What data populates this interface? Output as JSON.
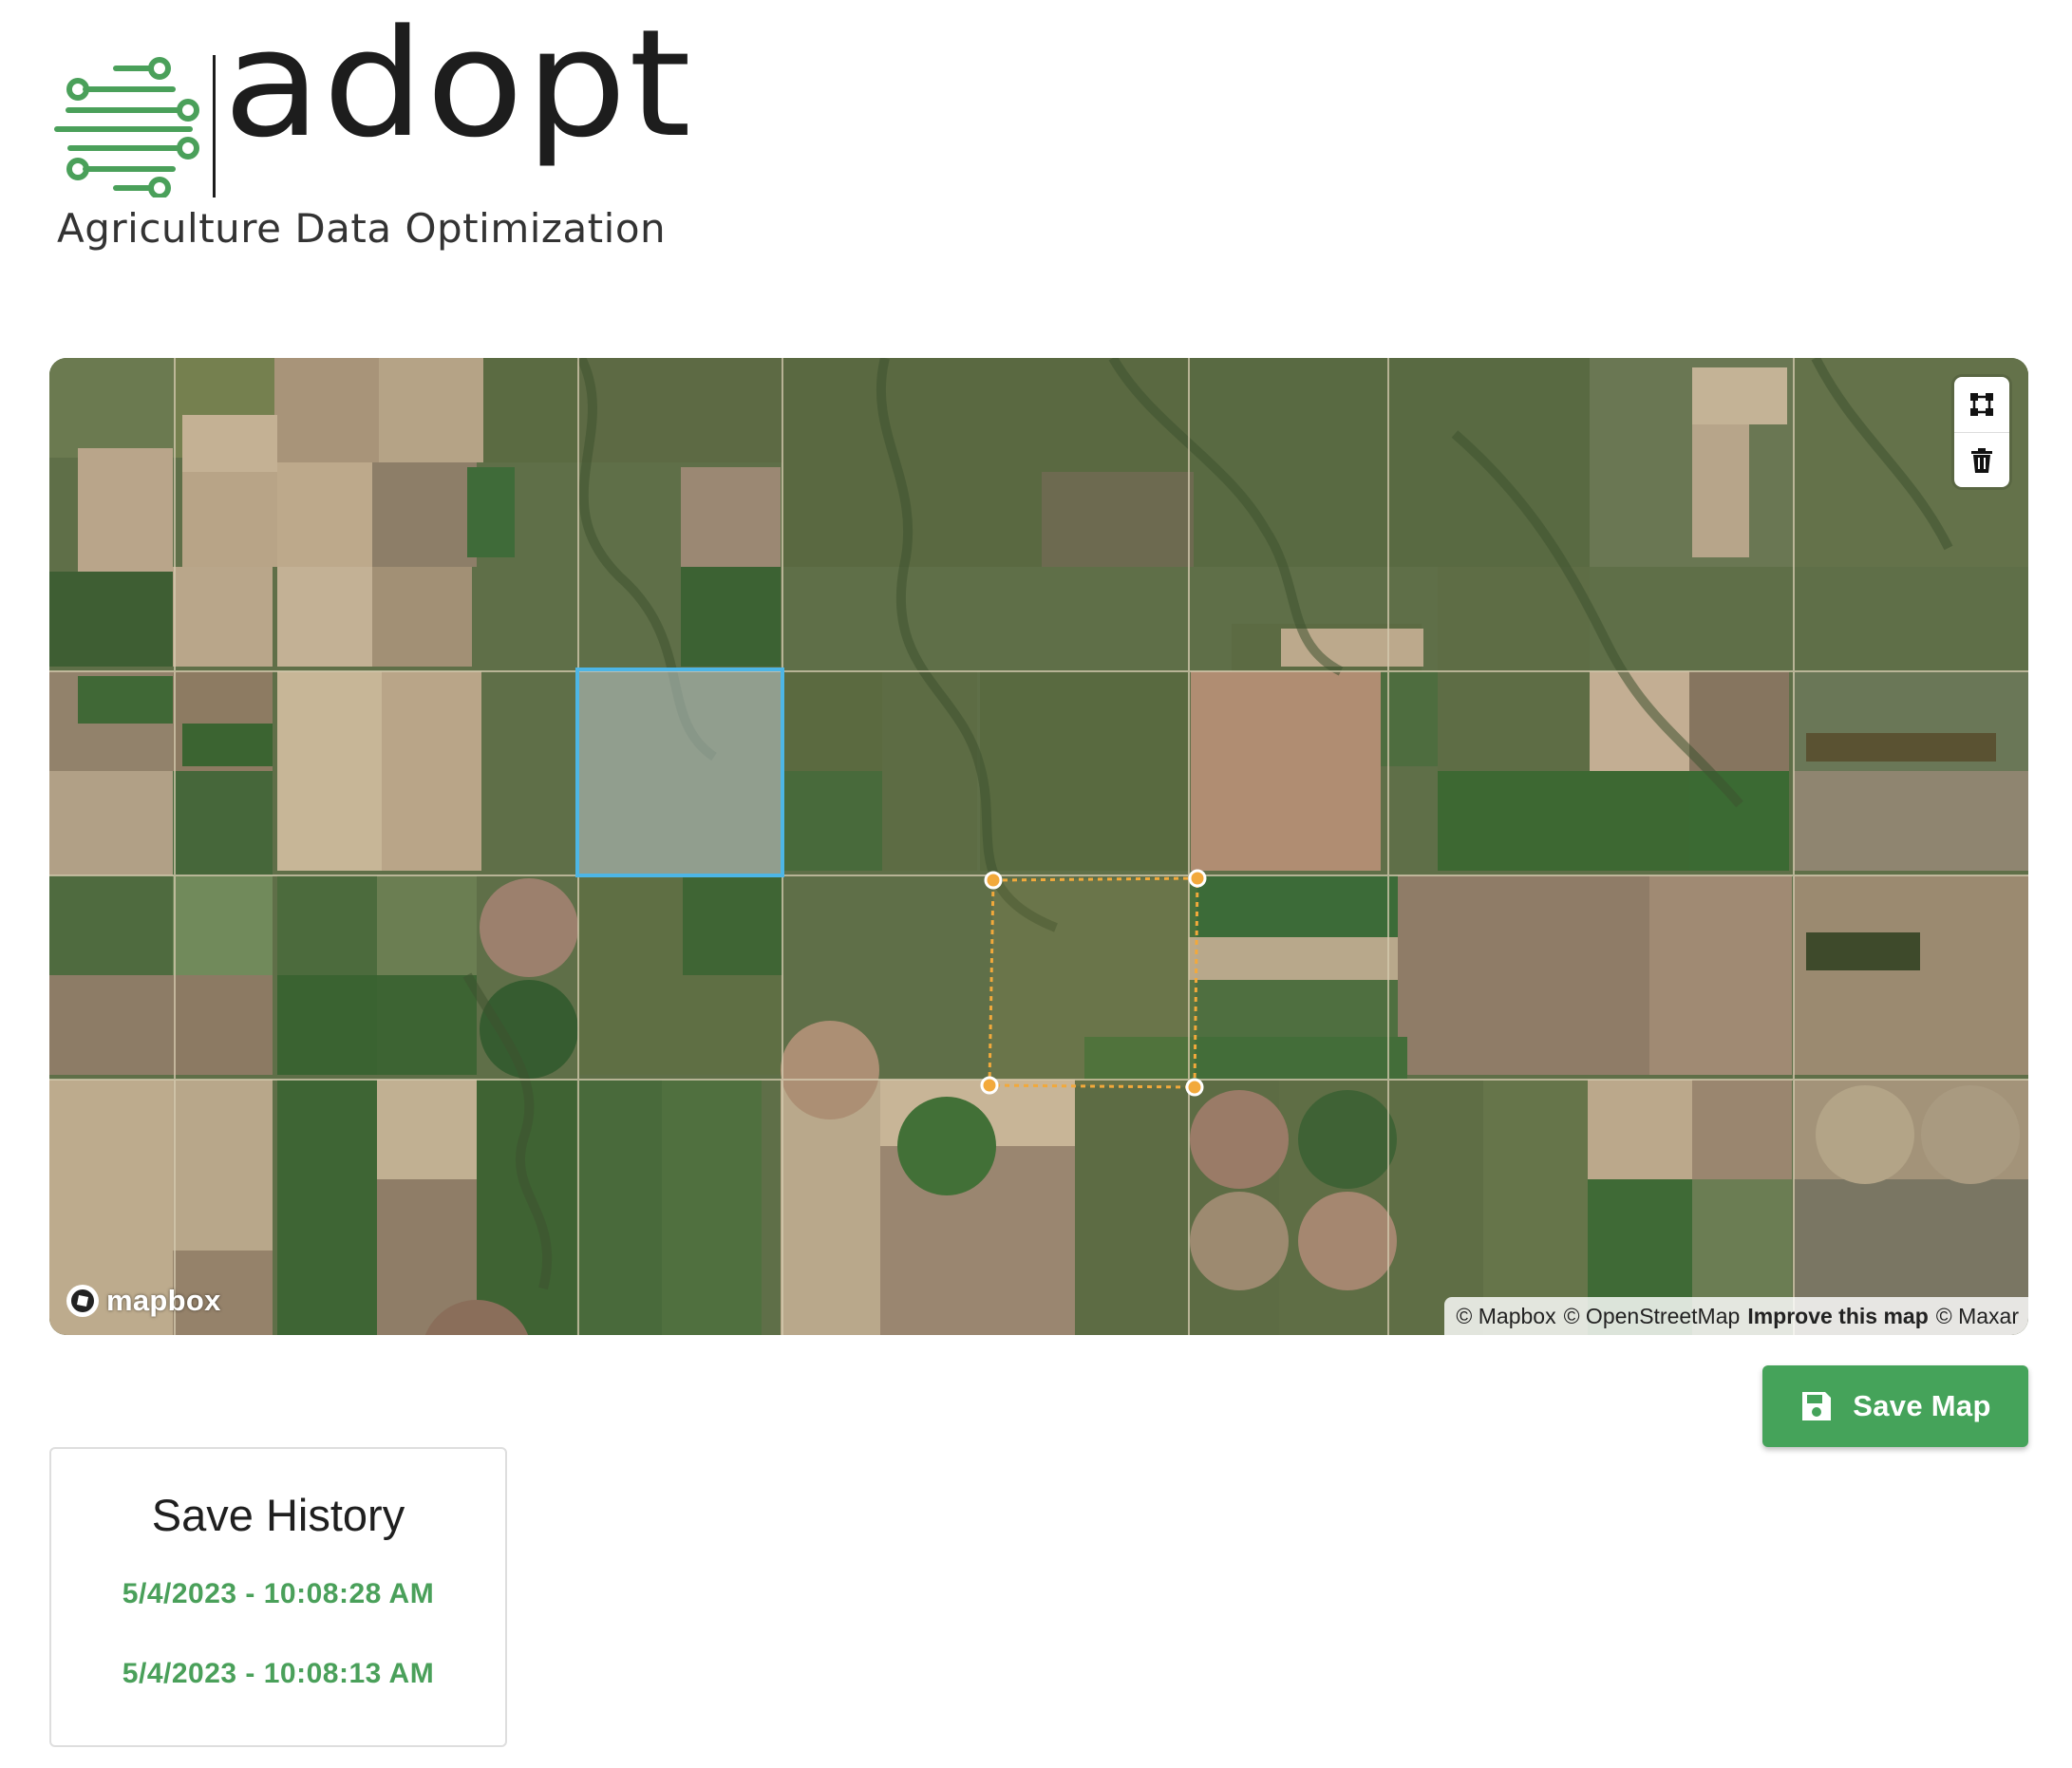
{
  "brand": {
    "name": "adopt",
    "tagline": "Agriculture Data Optimization",
    "logo_color": "#4aa05a"
  },
  "map": {
    "provider_logo": "mapbox",
    "controls": [
      {
        "icon": "polygon-draw-icon"
      },
      {
        "icon": "trash-icon"
      }
    ],
    "attribution": {
      "mapbox": "© Mapbox",
      "osm": "© OpenStreetMap",
      "improve": "Improve this map",
      "maxar": "© Maxar"
    },
    "selected_polygon_color": "#4db6e6",
    "active_polygon_color": "#f2a93b"
  },
  "actions": {
    "save_label": "Save Map",
    "save_icon": "floppy-disk-icon",
    "accent": "#45a35a"
  },
  "history": {
    "title": "Save History",
    "entries": [
      "5/4/2023 - 10:08:28 AM",
      "5/4/2023 - 10:08:13 AM"
    ]
  }
}
